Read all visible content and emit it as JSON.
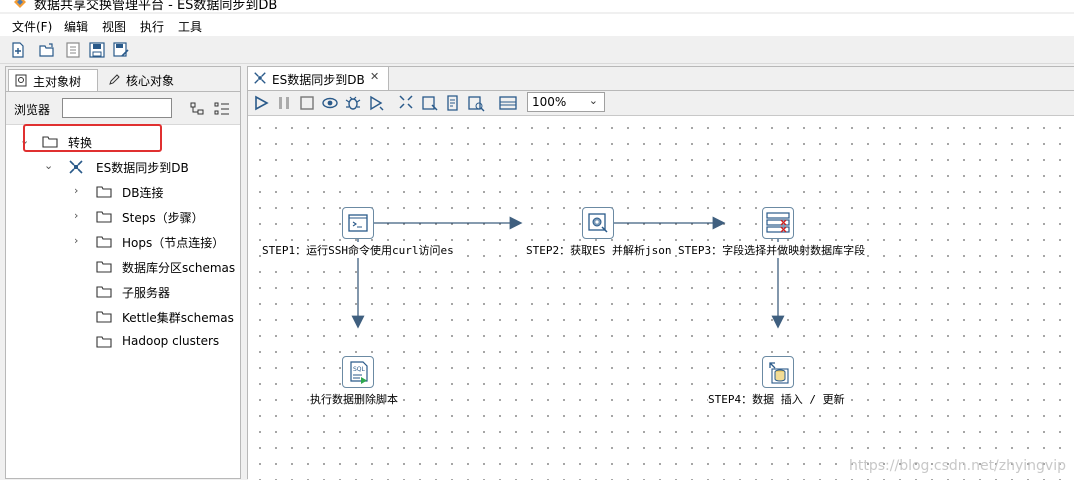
{
  "window": {
    "title": "数据共享交换管理平台 - ES数据同步到DB"
  },
  "menu": {
    "file": "文件(F)",
    "edit": "编辑",
    "view": "视图",
    "run": "执行",
    "tools": "工具"
  },
  "left_panel": {
    "tab_main": "主对象树",
    "tab_core": "核心对象",
    "browser_label": "浏览器",
    "search_value": "",
    "tree": {
      "root": "转换",
      "transformation": "ES数据同步到DB",
      "children": [
        "DB连接",
        "Steps（步骤）",
        "Hops（节点连接）",
        "数据库分区schemas",
        "子服务器",
        "Kettle集群schemas",
        "Hadoop clusters"
      ]
    }
  },
  "editor": {
    "tab_title": "ES数据同步到DB",
    "zoom": "100%",
    "steps": {
      "step1": "STEP1：运行SSH命令使用curl访问es",
      "step2": "STEP2：获取ES 并解析json",
      "step3": "STEP3：字段选择并做映射数据库字段",
      "step4": "STEP4：数据 插入 / 更新",
      "sql": "执行数据删除脚本"
    }
  },
  "watermark": "https://blog.csdn.net/zhyingvip",
  "colors": {
    "highlight": "#e03030",
    "hop": "#3f5f7f",
    "node_border": "#6b8aa3"
  }
}
